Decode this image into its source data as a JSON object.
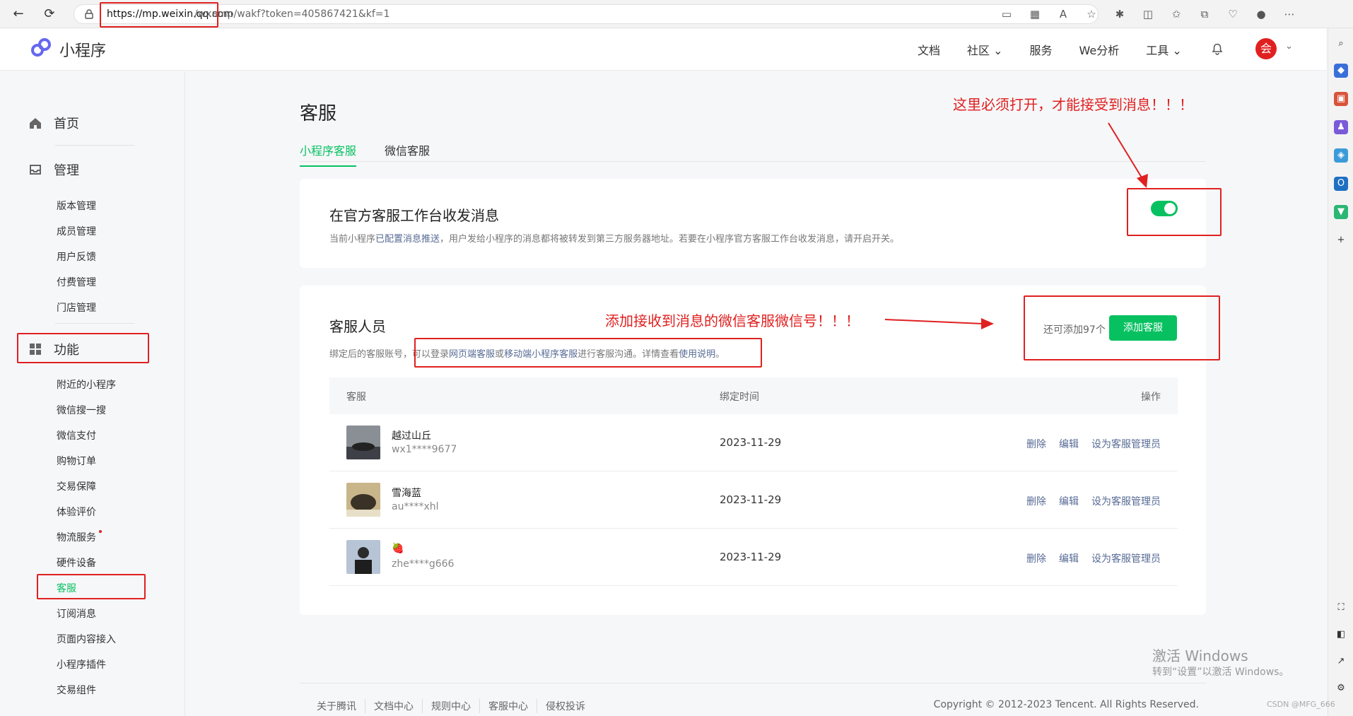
{
  "browser": {
    "url_host": "https://mp.weixin.qq.com",
    "url_rest": "/wxamp/wakf?token=405867421&kf=1"
  },
  "header": {
    "logo_text": "小程序",
    "nav": [
      "文档",
      "社区",
      "服务",
      "We分析",
      "工具"
    ],
    "avatar_char": "会"
  },
  "sidebar": {
    "home": "首页",
    "manage": "管理",
    "manage_items": [
      "版本管理",
      "成员管理",
      "用户反馈",
      "付费管理",
      "门店管理"
    ],
    "feature": "功能",
    "feature_items": [
      "附近的小程序",
      "微信搜一搜",
      "微信支付",
      "购物订单",
      "交易保障",
      "体验评价",
      "物流服务",
      "硬件设备",
      "客服",
      "订阅消息",
      "页面内容接入",
      "小程序插件",
      "交易组件"
    ],
    "active_item": "客服"
  },
  "main": {
    "title": "客服",
    "tabs": [
      "小程序客服",
      "微信客服"
    ],
    "card1": {
      "title": "在官方客服工作台收发消息",
      "desc_pre": "当前小程序",
      "desc_link": "已配置消息推送",
      "desc_post": "，用户发给小程序的消息都将被转发到第三方服务器地址。若要在小程序官方客服工作台收发消息，请开启开关。",
      "toggle_on": true
    },
    "card2": {
      "title": "客服人员",
      "desc_pre": "绑定后的客服账号，",
      "desc_mid1": "可以登录",
      "desc_link1": "网页端客服",
      "desc_mid2": "或",
      "desc_link2": "移动端小程序客服",
      "desc_mid3": "进行客服沟通。详情查看",
      "desc_link3": "使用说明",
      "desc_end": "。",
      "remain": "还可添加97个",
      "add_button": "添加客服",
      "columns": [
        "客服",
        "绑定时间",
        "操作"
      ],
      "rows": [
        {
          "name": "越过山丘",
          "id": "wx1****9677",
          "date": "2023-11-29"
        },
        {
          "name": "雪海蓝",
          "id": "au****xhl",
          "date": "2023-11-29"
        },
        {
          "name": "🍓",
          "id": "zhe****g666",
          "date": "2023-11-29"
        }
      ],
      "actions": [
        "删除",
        "编辑",
        "设为客服管理员"
      ]
    }
  },
  "annotations": {
    "top": "这里必须打开，才能接受到消息！！！",
    "mid": "添加接收到消息的微信客服微信号！！！"
  },
  "footer": {
    "links": [
      "关于腾讯",
      "文档中心",
      "规则中心",
      "客服中心",
      "侵权投诉"
    ],
    "copyright": "Copyright © 2012-2023 Tencent. All Rights Reserved."
  },
  "watermark": {
    "line1": "激活 Windows",
    "line2": "转到“设置”以激活 Windows。",
    "csdn": "CSDN @MFG_666"
  }
}
